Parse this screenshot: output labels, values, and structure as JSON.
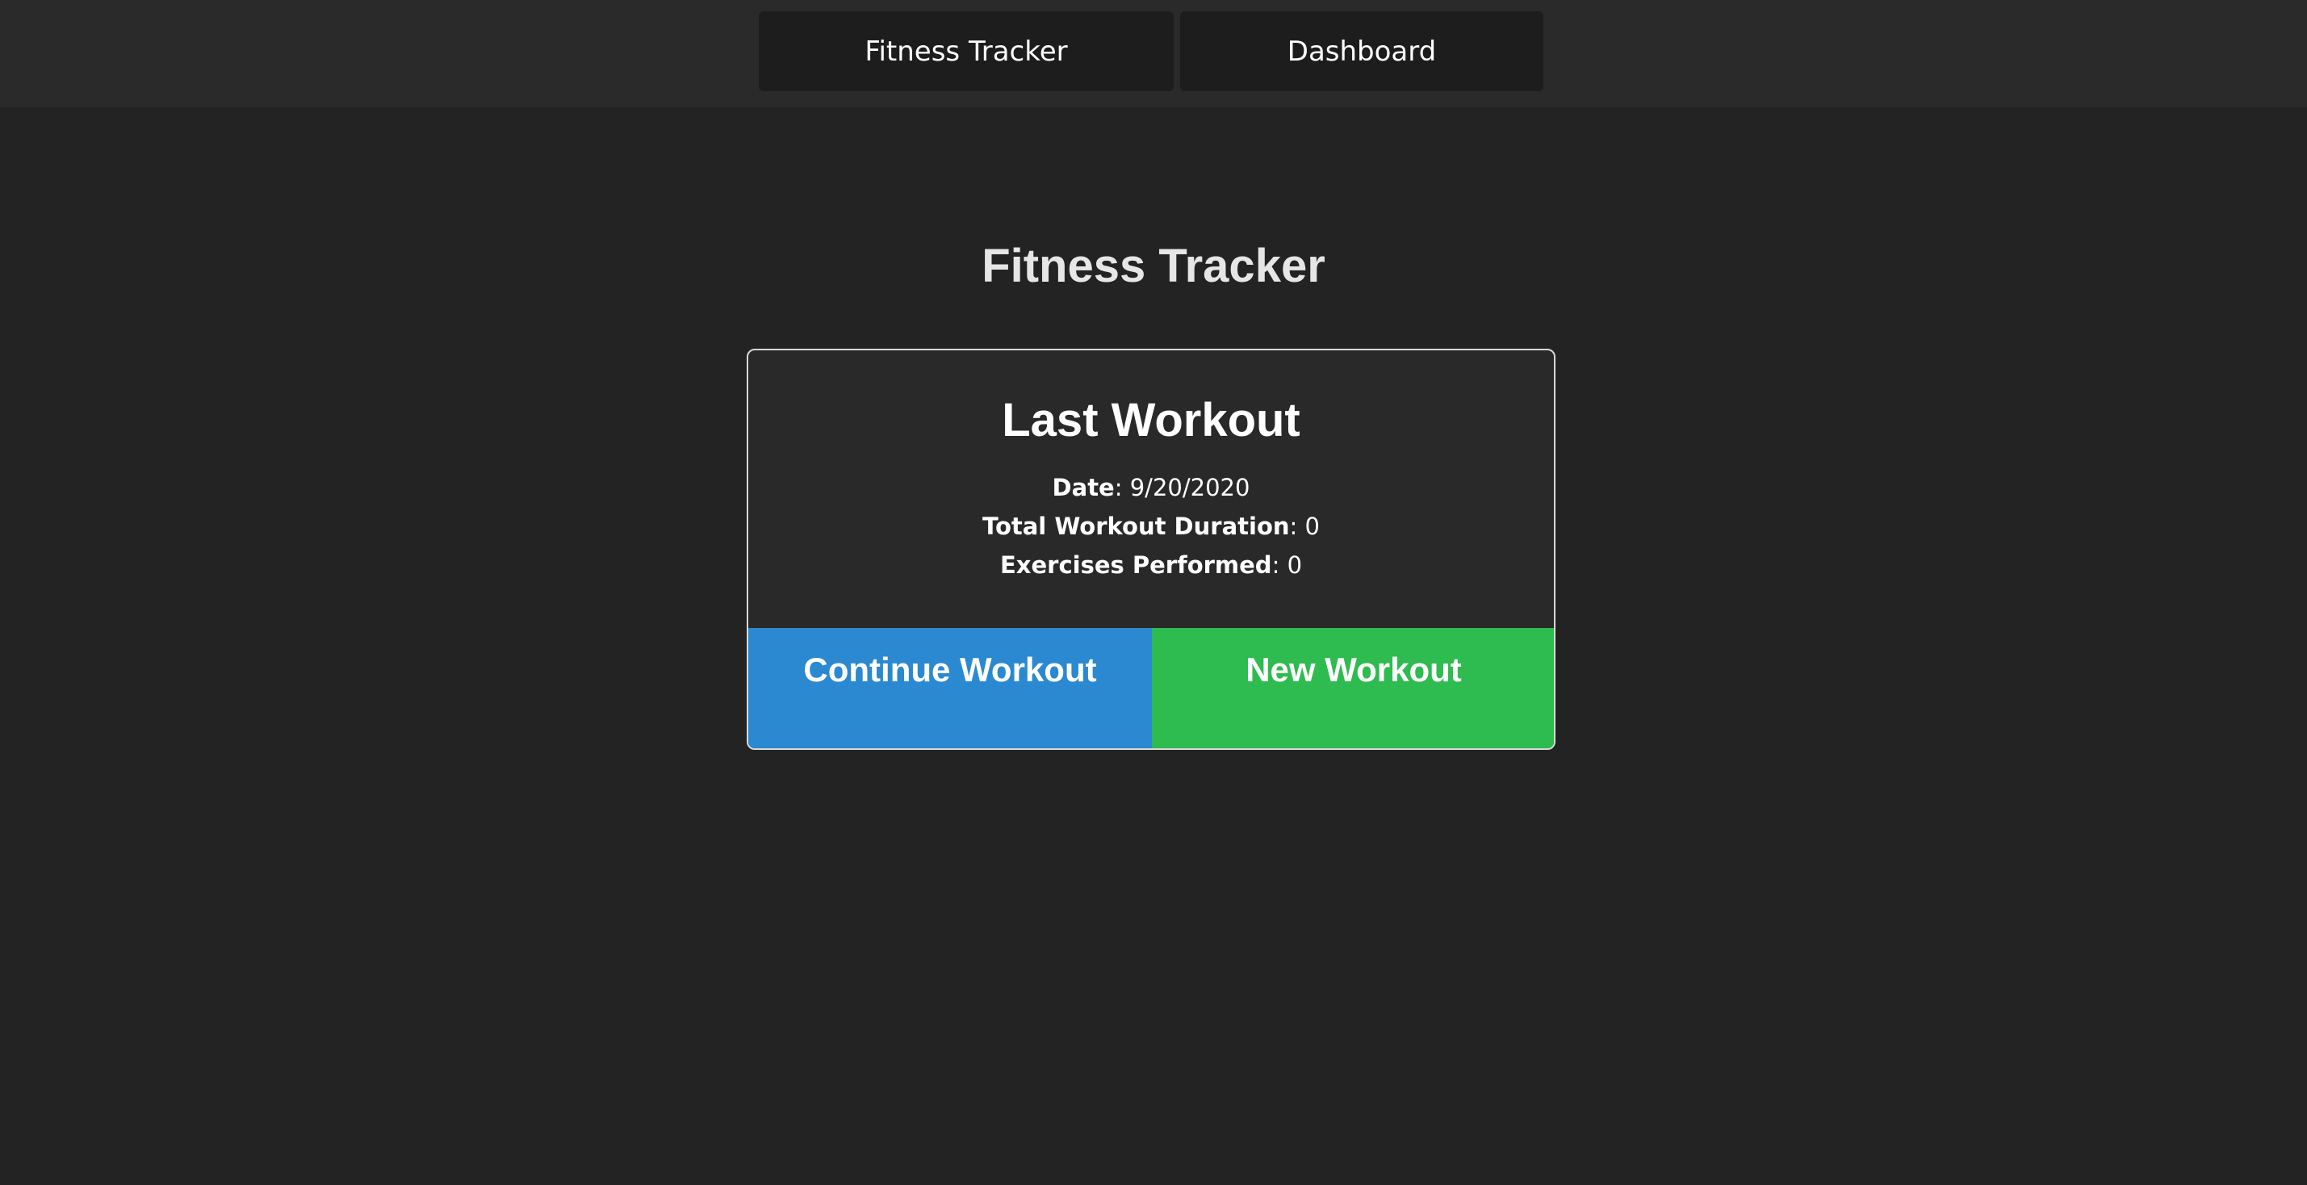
{
  "nav": {
    "fitness_tracker_label": "Fitness Tracker",
    "dashboard_label": "Dashboard"
  },
  "page": {
    "title": "Fitness Tracker"
  },
  "last_workout": {
    "title": "Last Workout",
    "date_label": "Date",
    "date_value": "9/20/2020",
    "duration_label": "Total Workout Duration",
    "duration_value": "0",
    "exercises_label": "Exercises Performed",
    "exercises_value": "0"
  },
  "actions": {
    "continue_label": "Continue Workout",
    "new_label": "New Workout"
  },
  "colors": {
    "background": "#232323",
    "continue_button": "#2a89d0",
    "new_button": "#2ebb4f"
  }
}
